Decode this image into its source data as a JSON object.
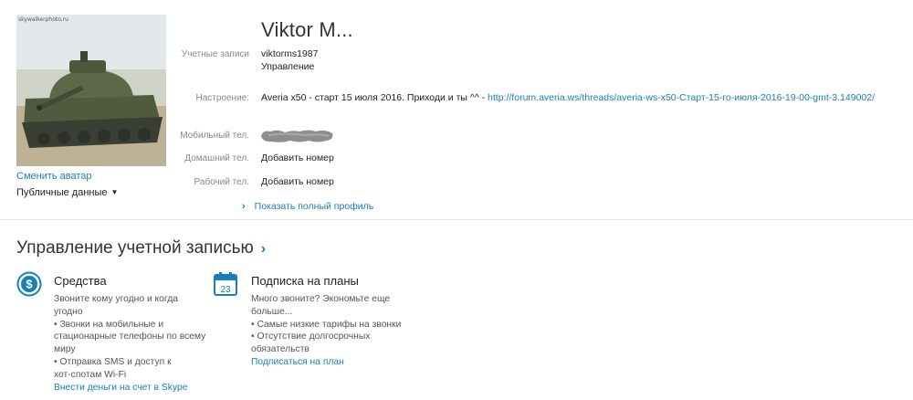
{
  "profile": {
    "name": "Viktor M...",
    "avatar_caption": "skywalkerphoto.ru",
    "change_avatar": "Сменить аватар",
    "public_data": "Публичные данные",
    "rows": {
      "accounts_label": "Учетные записи",
      "account_login": "viktorms1987",
      "account_manage": "Управление",
      "mood_label": "Настроение:",
      "mood_text": "Averia x50 - старт 15 июля 2016. Приходи и ты ^^ - ",
      "mood_link": "http://forum.averia.ws/threads/averia-ws-x50-Старт-15-го-июля-2016-19-00-gmt-3.149002/",
      "mobile_label": "Мобильный тел.",
      "home_label": "Домашний тел.",
      "home_add": "Добавить номер",
      "work_label": "Рабочий тел.",
      "work_add": "Добавить номер"
    },
    "show_full_profile": "Показать полный профиль"
  },
  "account": {
    "title": "Управление учетной записью",
    "funds": {
      "icon": "dollar-icon",
      "title": "Средства",
      "lines": [
        "Звоните кому угодно и когда",
        "угодно",
        "• Звонки на мобильные и",
        "стационарные телефоны по всему",
        "миру",
        "• Отправка SMS и доступ к",
        "хот-спотам Wi-Fi"
      ],
      "link": "Внести деньги на счет в Skype"
    },
    "plans": {
      "icon": "calendar-icon",
      "calendar_day": "23",
      "title": "Подписка на планы",
      "lines": [
        "Много звоните? Экономьте еще",
        "больше...",
        "• Самые низкие тарифы на звонки",
        "• Отсутствие долгосрочных",
        "обязательств"
      ],
      "link": "Подписаться на план"
    }
  },
  "colors": {
    "accent": "#1a7fb8",
    "text": "#333333",
    "muted": "#888888"
  }
}
